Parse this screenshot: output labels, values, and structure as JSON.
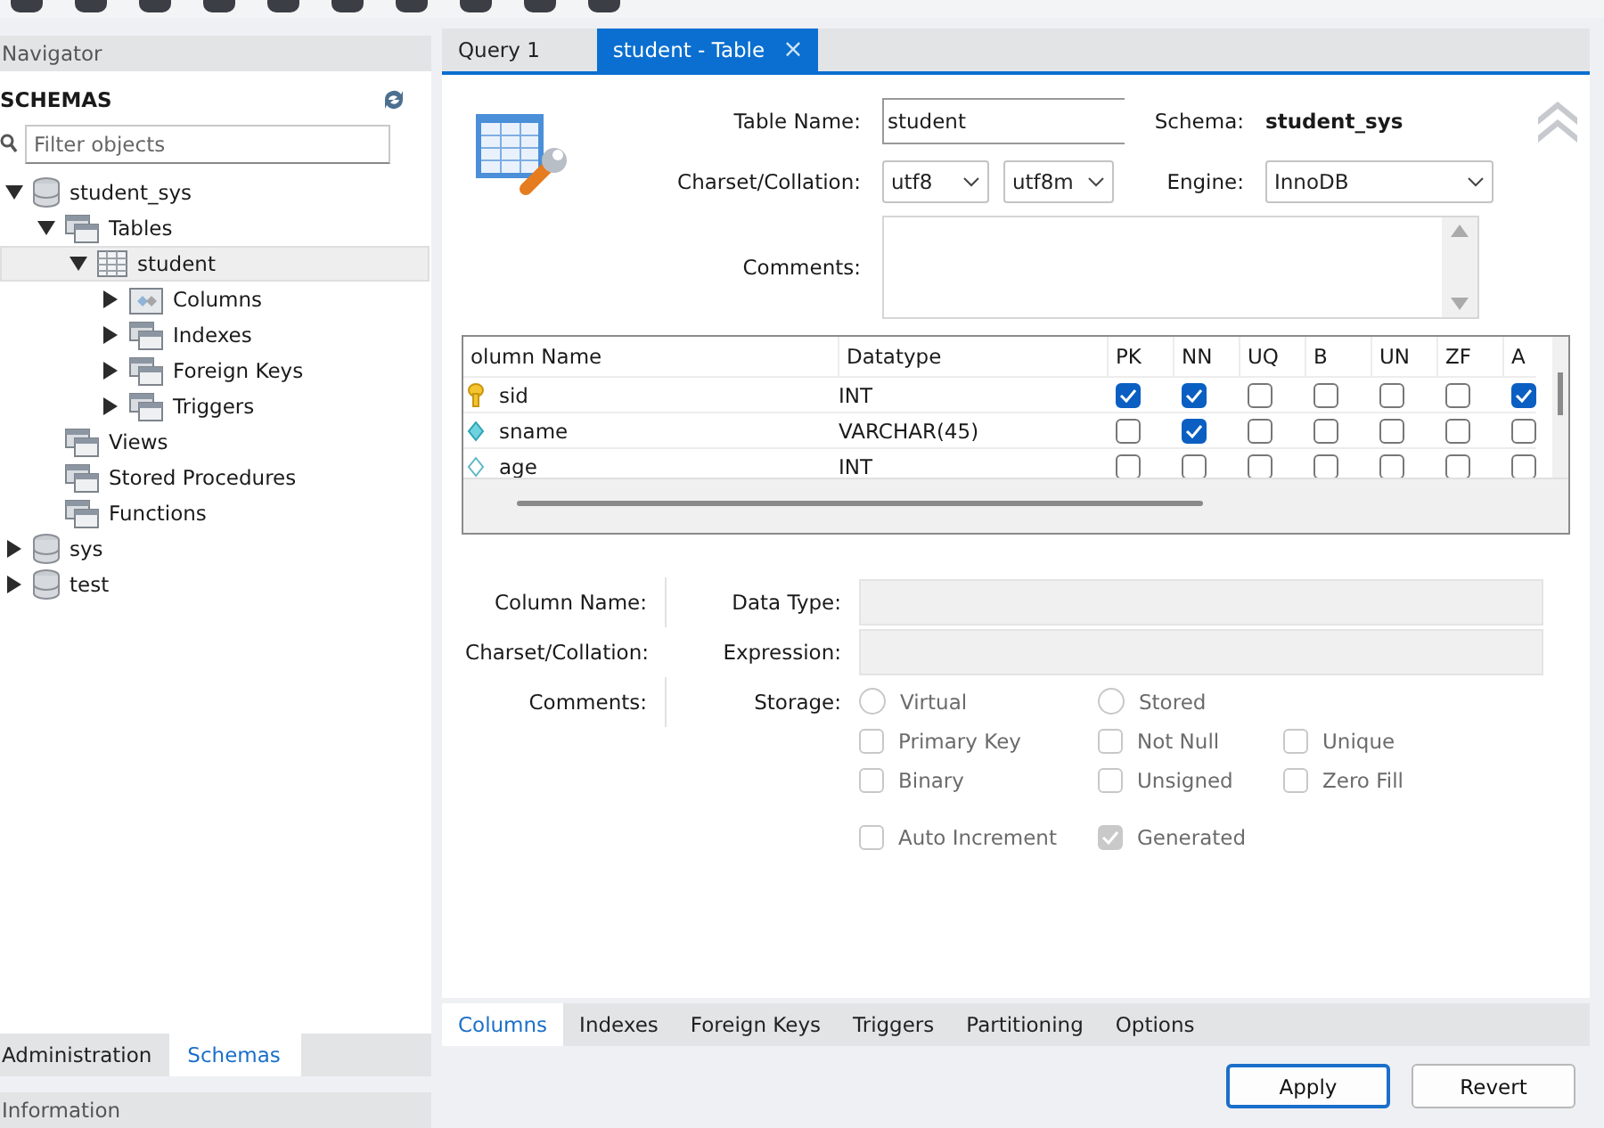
{
  "navigator": {
    "title": "Navigator",
    "section": "SCHEMAS",
    "filter": {
      "placeholder": "Filter objects"
    },
    "tree": [
      {
        "label": "student_sys",
        "kind": "schema",
        "expanded": true,
        "selected": false,
        "children": [
          {
            "label": "Tables",
            "kind": "folder",
            "expanded": true,
            "selected": false,
            "children": [
              {
                "label": "student",
                "kind": "table",
                "expanded": true,
                "selected": true,
                "children": [
                  {
                    "label": "Columns",
                    "kind": "columns",
                    "expanded": false,
                    "selected": false
                  },
                  {
                    "label": "Indexes",
                    "kind": "folder",
                    "expanded": false,
                    "selected": false
                  },
                  {
                    "label": "Foreign Keys",
                    "kind": "folder",
                    "expanded": false,
                    "selected": false
                  },
                  {
                    "label": "Triggers",
                    "kind": "folder",
                    "expanded": false,
                    "selected": false
                  }
                ]
              }
            ]
          },
          {
            "label": "Views",
            "kind": "folder",
            "selected": false
          },
          {
            "label": "Stored Procedures",
            "kind": "folder",
            "selected": false
          },
          {
            "label": "Functions",
            "kind": "folder",
            "selected": false
          }
        ]
      },
      {
        "label": "sys",
        "kind": "schema",
        "expanded": false,
        "selected": false
      },
      {
        "label": "test",
        "kind": "schema",
        "expanded": false,
        "selected": false
      }
    ],
    "tabs": [
      {
        "label": "Administration",
        "selected": false
      },
      {
        "label": "Schemas",
        "selected": true
      }
    ],
    "info_title": "Information"
  },
  "editor": {
    "tabs": [
      {
        "label": "Query 1",
        "selected": false
      },
      {
        "label": "student - Table",
        "selected": true,
        "close": "×"
      }
    ],
    "table_name": {
      "label": "Table Name:",
      "value": "student"
    },
    "schema": {
      "label": "Schema:",
      "value": "student_sys"
    },
    "charset": {
      "label": "Charset/Collation:",
      "charset": "utf8",
      "collation": "utf8m"
    },
    "engine": {
      "label": "Engine:",
      "value": "InnoDB"
    },
    "comments": {
      "label": "Comments:"
    },
    "grid": {
      "columns": [
        "olumn Name",
        "Datatype",
        "PK",
        "NN",
        "UQ",
        "B",
        "UN",
        "ZF",
        "A"
      ],
      "rows": [
        {
          "name": "sid",
          "kind": "key",
          "type": "INT",
          "flags": [
            true,
            true,
            false,
            false,
            false,
            false,
            true
          ]
        },
        {
          "name": "sname",
          "kind": "indexed",
          "type": "VARCHAR(45)",
          "flags": [
            false,
            true,
            false,
            false,
            false,
            false,
            false
          ]
        },
        {
          "name": "age",
          "kind": "plain",
          "type": "INT",
          "flags": [
            false,
            false,
            false,
            false,
            false,
            false,
            false
          ]
        }
      ]
    },
    "details": {
      "column_name": "Column Name:",
      "data_type": "Data Type:",
      "charset": "Charset/Collation:",
      "expression": "Expression:",
      "comments": "Comments:",
      "storage": "Storage:",
      "storage_options": [
        {
          "label": "Virtual",
          "selected": false
        },
        {
          "label": "Stored",
          "selected": false
        }
      ],
      "checks": [
        {
          "label": "Primary Key",
          "checked": false
        },
        {
          "label": "Not Null",
          "checked": false
        },
        {
          "label": "Unique",
          "checked": false
        },
        {
          "label": "Binary",
          "checked": false
        },
        {
          "label": "Unsigned",
          "checked": false
        },
        {
          "label": "Zero Fill",
          "checked": false
        },
        {
          "label": "Auto Increment",
          "checked": false
        },
        {
          "label": "Generated",
          "checked": true
        }
      ],
      "disabled": true
    },
    "bottom_tabs": [
      {
        "label": "Columns",
        "selected": true
      },
      {
        "label": "Indexes",
        "selected": false
      },
      {
        "label": "Foreign Keys",
        "selected": false
      },
      {
        "label": "Triggers",
        "selected": false
      },
      {
        "label": "Partitioning",
        "selected": false
      },
      {
        "label": "Options",
        "selected": false
      }
    ],
    "buttons": [
      {
        "label": "Apply",
        "kind": "default"
      },
      {
        "label": "Revert",
        "kind": "normal"
      }
    ]
  }
}
